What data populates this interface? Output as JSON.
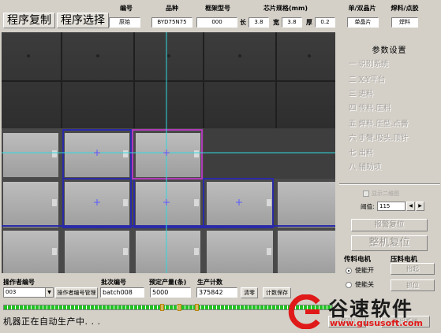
{
  "toolbar": {
    "copy_program": "程序复制",
    "select_program": "程序选择"
  },
  "header": {
    "code_label": "编号",
    "code_value": "原始",
    "variety_label": "品种",
    "variety_value": "BYD75N75",
    "frame_label": "框架型号",
    "frame_value": "000",
    "chip_spec_label": "芯片规格(mm)",
    "length_label": "长",
    "length_value": "3.8",
    "width_label": "宽",
    "width_value": "3.8",
    "thickness_label": "厚",
    "thickness_value": "0.2",
    "chip_type_label": "单/双晶片",
    "chip_type_value": "单晶片",
    "solder_label": "焊料/点胶",
    "solder_value": "焊料"
  },
  "params": {
    "title": "参数设置",
    "items": [
      "一 识别系统",
      "二 X-Y平台",
      "三 进料",
      "四 传料.压料",
      "五 焊料.压型.点膏",
      "六 手臂.吸头.顶针",
      "七 出料",
      "八 辅助项"
    ],
    "show_second_grab": "显示二维图",
    "threshold_label": "阈值:",
    "threshold_value": "115",
    "alarm_reset": "报警复位",
    "machine_reset": "整机复位"
  },
  "motors": {
    "transfer_label": "传料电机",
    "press_label": "压料电机",
    "option_on": "使能开",
    "option_off": "使能关",
    "press_btn1": "抬起",
    "press_btn2": "抓位"
  },
  "bottom": {
    "operator_label": "操作者编号",
    "operator_value": "003",
    "operator_manage": "操作者编号管理",
    "batch_label": "批次编号",
    "batch_value": "batch008",
    "planned_label": "预定产量(条)",
    "planned_value": "5000",
    "count_label": "生产计数",
    "count_value": "375842",
    "clear_btn": "清零",
    "save_btn": "计数保存",
    "status": "机器正在自动生产中. . .",
    "progress_percent": 100
  },
  "corner_buttons": {
    "help": "(帮助)",
    "exit": "退出系统"
  },
  "watermark": {
    "brand": "谷速软件",
    "url": "www.gususoft.com"
  },
  "colors": {
    "window_bg": "#d4d0c8",
    "crosshair": "#2fd8e0",
    "detect_box": "#2a2aa8",
    "selected_box": "#b03ab8",
    "progress": "#22c322",
    "brand_red": "#e01919"
  }
}
